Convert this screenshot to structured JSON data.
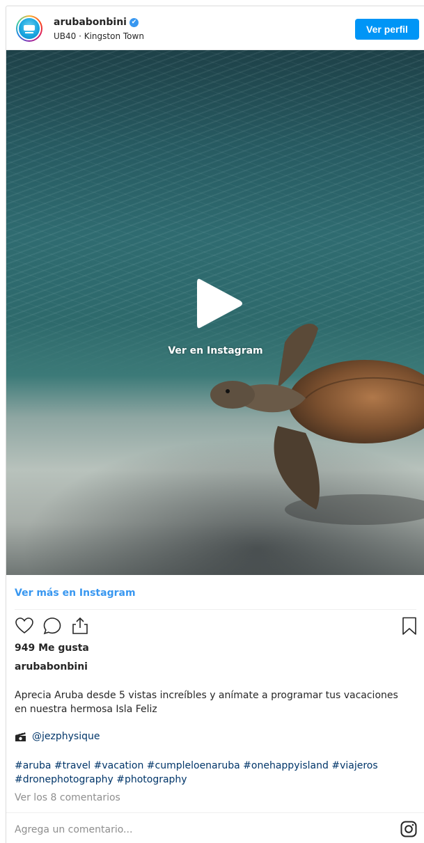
{
  "header": {
    "username": "arubabonbini",
    "verified_mark": "✔",
    "location": "UB40 · Kingston Town",
    "profile_button": "Ver perfil"
  },
  "media": {
    "overlay_text": "Ver en Instagram",
    "play_icon": "play-icon"
  },
  "footer": {
    "more_link": "Ver más en Instagram",
    "likes": "949 Me gusta",
    "author": "arubabonbini",
    "caption": "Aprecia Aruba desde 5 vistas increíbles y anímate a programar tus vacaciones en nuestra hermosa Isla Feliz",
    "credit_icon": "clapperboard-icon",
    "credit": "@jezphysique",
    "hashtags": "#aruba #travel #vacation #cumpleloenaruba #onehappyisland #viajeros #dronephotography #photography",
    "comments_link": "Ver los 8 comentarios",
    "comment_placeholder": "Agrega un comentario..."
  },
  "icons": {
    "like": "heart-icon",
    "comment": "comment-icon",
    "share": "share-icon",
    "save": "bookmark-icon",
    "instagram": "instagram-icon"
  },
  "colors": {
    "accent": "#0095f6",
    "link": "#3897f0",
    "hashtag": "#003569",
    "muted": "#8e8e8e"
  }
}
